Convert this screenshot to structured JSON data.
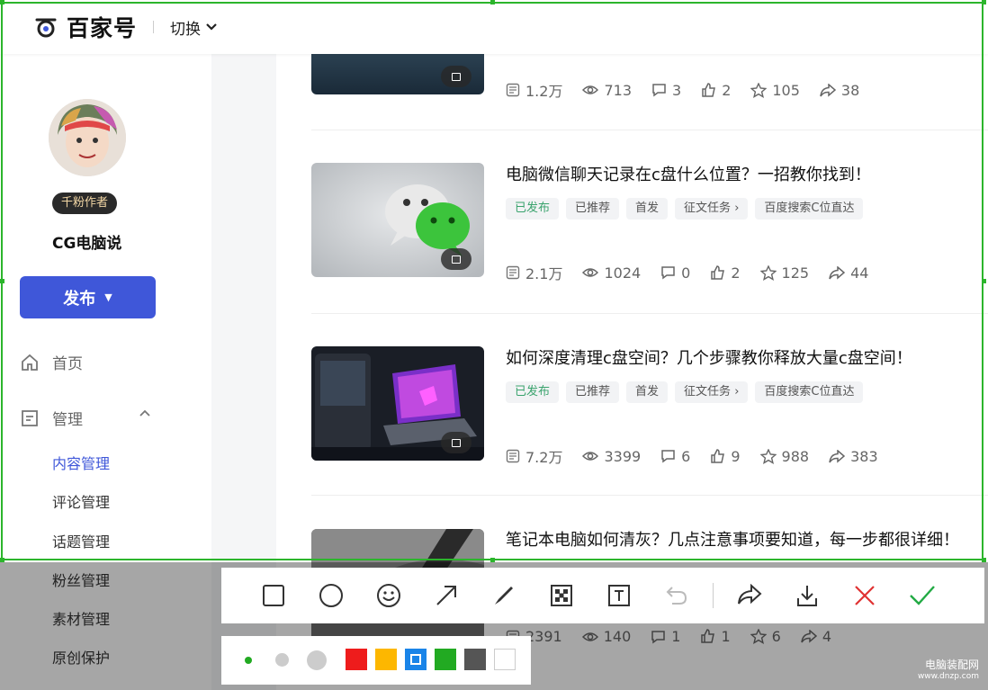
{
  "header": {
    "logo_text": "百家号",
    "switch_label": "切换"
  },
  "sidebar": {
    "badge": "千粉作者",
    "username": "CG电脑说",
    "publish_label": "发布",
    "nav": [
      {
        "label": "首页",
        "icon": "home-icon"
      },
      {
        "label": "管理",
        "icon": "manage-icon"
      }
    ],
    "sub_items": [
      "内容管理",
      "评论管理",
      "话题管理",
      "粉丝管理",
      "素材管理",
      "原创保护"
    ]
  },
  "articles": [
    {
      "title": "",
      "stats": {
        "read": "1.2万",
        "views": "713",
        "comments": "3",
        "likes": "2",
        "favorites": "105",
        "shares": "38"
      }
    },
    {
      "title": "电脑微信聊天记录在c盘什么位置？一招教你找到！",
      "tags": [
        "已发布",
        "已推荐",
        "首发",
        "征文任务",
        "百度搜索C位直达"
      ],
      "stats": {
        "read": "2.1万",
        "views": "1024",
        "comments": "0",
        "likes": "2",
        "favorites": "125",
        "shares": "44"
      }
    },
    {
      "title": "如何深度清理c盘空间？几个步骤教你释放大量c盘空间！",
      "tags": [
        "已发布",
        "已推荐",
        "首发",
        "征文任务",
        "百度搜索C位直达"
      ],
      "stats": {
        "read": "7.2万",
        "views": "3399",
        "comments": "6",
        "likes": "9",
        "favorites": "988",
        "shares": "383"
      }
    },
    {
      "title": "笔记本电脑如何清灰？几点注意事项要知道，每一步都很详细！",
      "stats": {
        "read": "2391",
        "views": "140",
        "comments": "1",
        "likes": "1",
        "favorites": "6",
        "shares": "4"
      }
    }
  ],
  "toolbar": {
    "tools": [
      "rectangle-icon",
      "ellipse-icon",
      "emoji-icon",
      "arrow-icon",
      "pen-icon",
      "mosaic-icon",
      "text-icon",
      "undo-icon",
      "share-icon",
      "download-icon",
      "close-icon",
      "confirm-icon"
    ],
    "colors": [
      "#ee1c1c",
      "#fdb700",
      "#1a84e8",
      "#22aa22",
      "#555555",
      "#ffffff"
    ],
    "accent_selection": "#2cb52c"
  },
  "watermark": {
    "text": "电脑装配网",
    "url": "www.dnzp.com"
  }
}
